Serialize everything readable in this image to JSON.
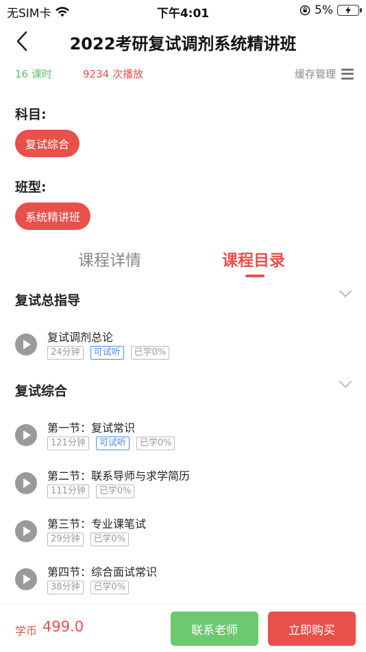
{
  "status_bar": {
    "carrier": "无SIM卡",
    "time": "下午4:01",
    "battery": "5%"
  },
  "header": {
    "title": "2022考研复试调剂系统精讲班"
  },
  "meta": {
    "lessons": "16 课时",
    "plays": "9234 次播放",
    "cache": "缓存管理"
  },
  "subject": {
    "label": "科目:",
    "value": "复试综合"
  },
  "class_type": {
    "label": "班型:",
    "value": "系统精讲班"
  },
  "tabs": [
    {
      "label": "课程详情"
    },
    {
      "label": "课程目录"
    }
  ],
  "groups": [
    {
      "title": "复试总指导",
      "lessons": [
        {
          "title": "复试调剂总论",
          "duration": "24分钟",
          "trial": "可试听",
          "progress": "已学0%"
        }
      ]
    },
    {
      "title": "复试综合",
      "lessons": [
        {
          "title": "第一节：复试常识",
          "duration": "121分钟",
          "trial": "可试听",
          "progress": "已学0%"
        },
        {
          "title": "第二节：联系导师与求学简历",
          "duration": "111分钟",
          "progress": "已学0%"
        },
        {
          "title": "第三节：专业课笔试",
          "duration": "29分钟",
          "progress": "已学0%"
        },
        {
          "title": "第四节：综合面试常识",
          "duration": "38分钟",
          "progress": "已学0%"
        }
      ]
    }
  ],
  "bottom": {
    "price_label": "学币",
    "price_value": "499.0",
    "contact_label": "联系老师",
    "buy_label": "立即购买"
  },
  "colors": {
    "accent": "#e8504a",
    "green": "#6cc96f",
    "trial_blue": "#4a8be8"
  }
}
